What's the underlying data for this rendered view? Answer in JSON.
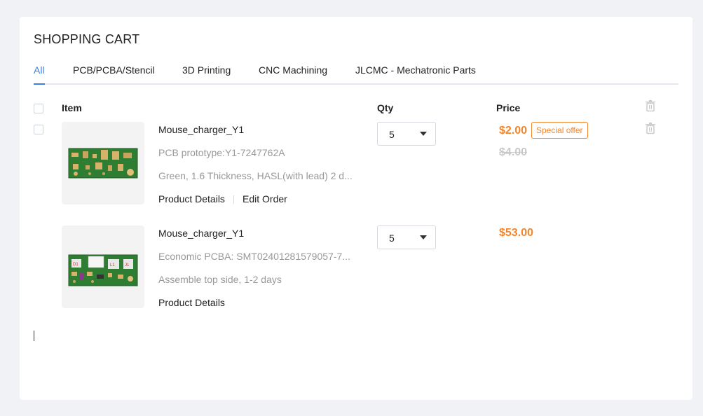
{
  "cart": {
    "title": "SHOPPING CART",
    "tabs": [
      {
        "label": "All",
        "active": true
      },
      {
        "label": "PCB/PCBA/Stencil",
        "active": false
      },
      {
        "label": "3D Printing",
        "active": false
      },
      {
        "label": "CNC Machining",
        "active": false
      },
      {
        "label": "JLCMC - Mechatronic Parts",
        "active": false
      }
    ],
    "columns": {
      "item": "Item",
      "qty": "Qty",
      "price": "Price"
    },
    "items": [
      {
        "name": "Mouse_charger_Y1",
        "line1": "PCB prototype:Y1-7247762A",
        "line2": "Green, 1.6 Thickness, HASL(with lead) 2 d...",
        "link_details": "Product Details",
        "link_edit": "Edit Order",
        "qty": "5",
        "price": "$2.00",
        "badge": "Special offer",
        "old_price": "$4.00",
        "thumb_icon": "pcb-board-image"
      },
      {
        "name": "Mouse_charger_Y1",
        "line1": "Economic PCBA: SMT02401281579057-7...",
        "line2": "Assemble top side, 1-2 days",
        "link_details": "Product Details",
        "qty": "5",
        "price": "$53.00",
        "thumb_icon": "pcba-board-image"
      }
    ]
  },
  "colors": {
    "accent": "#3b7fe0",
    "price": "#f2862e",
    "board_green": "#2e7d32"
  }
}
